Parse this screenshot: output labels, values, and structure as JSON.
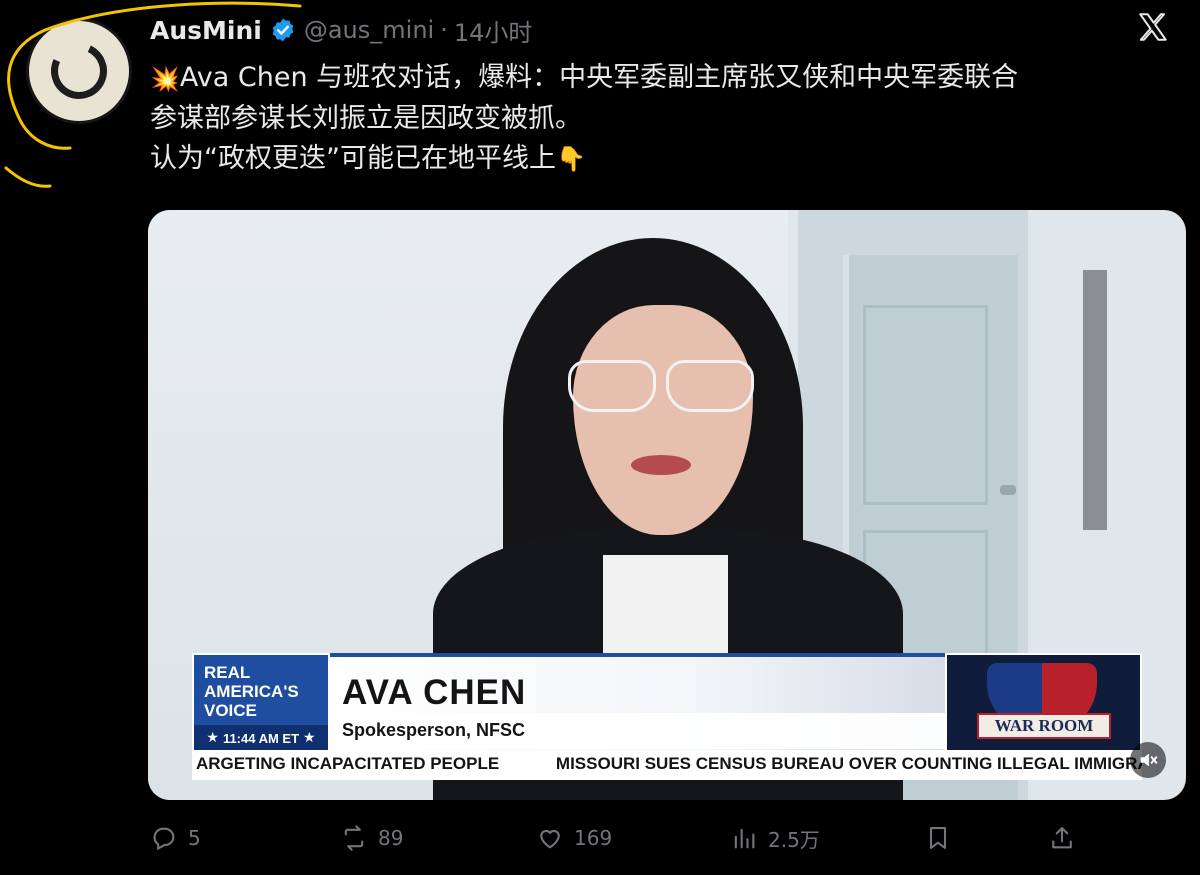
{
  "tweet": {
    "display_name": "AusMini",
    "handle": "@aus_mini",
    "separator": "·",
    "time": "14小时",
    "text_lines": [
      "Ava Chen 与班农对话，爆料：中央军委副主席张又侠和中央军委联合",
      "参谋部参谋长刘振立是因政变被抓。",
      "认为“政权更迭”可能已在地平线上"
    ],
    "emoji_lead": "💥",
    "emoji_trail": "👇"
  },
  "video": {
    "network_logo": {
      "line1": "REAL",
      "line2": "AMERICA'S",
      "line3": "VOICE",
      "time": "11:44 AM ET"
    },
    "guest_name": "AVA CHEN",
    "guest_title": "Spokesperson, NFSC",
    "show_logo": "WAR ROOM",
    "ticker": {
      "item1": "ARGETING INCAPACITATED PEOPLE",
      "item2": "MISSOURI SUES CENSUS BUREAU OVER COUNTING ILLEGAL IMMIGRA"
    }
  },
  "actions": {
    "replies": "5",
    "reposts": "89",
    "likes": "169",
    "views": "2.5万"
  },
  "icons": {
    "verified": "verified-badge-icon",
    "x_logo": "x-logo-icon",
    "reply": "reply-icon",
    "repost": "repost-icon",
    "like": "heart-icon",
    "views": "views-chart-icon",
    "bookmark": "bookmark-icon",
    "share": "share-icon",
    "mute": "mute-icon"
  },
  "colors": {
    "background": "#000000",
    "text_primary": "#e7e9ea",
    "text_secondary": "#71767b",
    "verified_blue": "#1d9bf0",
    "network_blue": "#1f4da0",
    "highlight_yellow": "#f5c400"
  }
}
